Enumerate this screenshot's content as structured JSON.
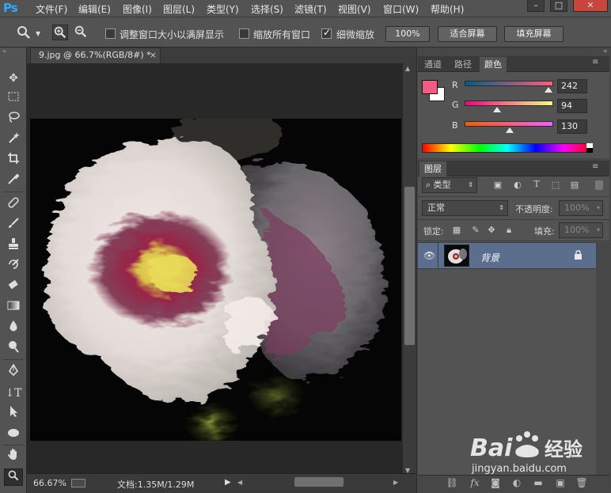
{
  "app": {
    "logo": "Ps"
  },
  "menu": [
    "文件(F)",
    "编辑(E)",
    "图像(I)",
    "图层(L)",
    "类型(Y)",
    "选择(S)",
    "滤镜(T)",
    "视图(V)",
    "窗口(W)",
    "帮助(H)"
  ],
  "window_controls": {
    "minimize": "–",
    "restore": "□",
    "close": "✕"
  },
  "options": {
    "resize_windows_label": "调整窗口大小以满屏显示",
    "zoom_all_label": "缩放所有窗口",
    "scrubby_zoom_label": "细微缩放",
    "btn_100": "100%",
    "btn_fit": "适合屏幕",
    "btn_fill": "填充屏幕"
  },
  "document": {
    "tab_title": "9.jpg @ 66.7%(RGB/8#) *",
    "zoom": "66.67%",
    "doc_size": "文档:1.35M/1.29M"
  },
  "color_panel": {
    "tabs": [
      "通道",
      "路径",
      "颜色"
    ],
    "active_tab": "颜色",
    "r_label": "R",
    "g_label": "G",
    "b_label": "B",
    "r": "242",
    "g": "94",
    "b": "130",
    "r_fraction": 0.95,
    "g_fraction": 0.37,
    "b_fraction": 0.51,
    "foreground": "#f25e82",
    "background": "#ffffff"
  },
  "layers_panel": {
    "tab": "图层",
    "filter_kind": "类型",
    "blend_mode": "正常",
    "opacity_label": "不透明度:",
    "opacity": "100%",
    "lock_label": "锁定:",
    "fill_label": "填充:",
    "fill": "100%",
    "layers": [
      {
        "name": "背景",
        "visible": true,
        "locked": true
      }
    ]
  },
  "watermark": {
    "brand": "Baidu",
    "brand_cn": "经验",
    "url": "jingyan.baidu.com"
  }
}
